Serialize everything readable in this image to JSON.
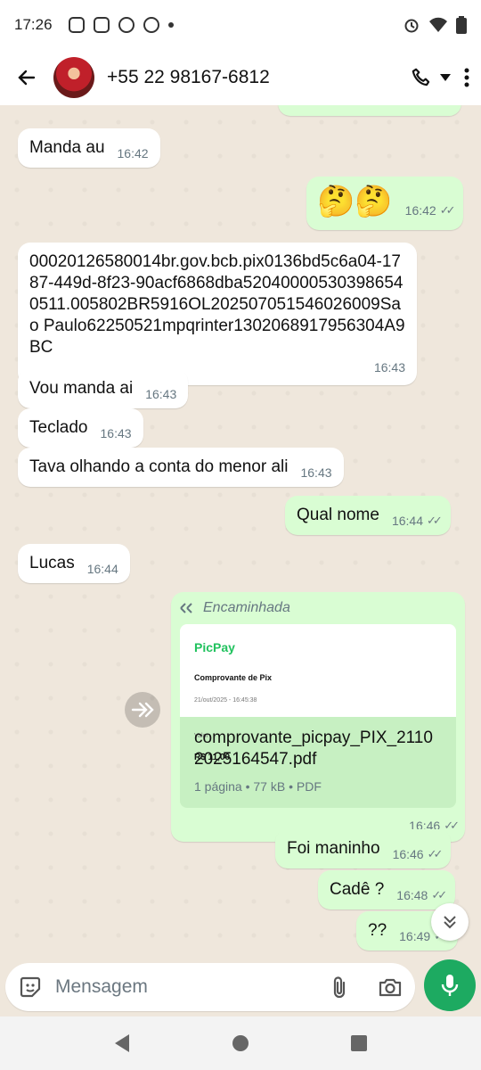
{
  "status_bar": {
    "time": "17:26"
  },
  "header": {
    "contact": "+55 22 98167-6812"
  },
  "messages": [
    {
      "dir": "in",
      "text": "Manda au",
      "time": "16:42"
    },
    {
      "dir": "out",
      "text": "🤔🤔",
      "time": "16:42"
    },
    {
      "dir": "in",
      "text": "00020126580014br.gov.bcb.pix0136bd5c6a04-1787-449d-8f23-90acf6868dba520400005303986540511.005802BR5916OL202507051546026009Sao Paulo62250521mpqrinter1302068917956304A9BC",
      "time": "16:43"
    },
    {
      "dir": "in",
      "text": "Vou manda ai",
      "time": "16:43"
    },
    {
      "dir": "in",
      "text": "Teclado",
      "time": "16:43"
    },
    {
      "dir": "in",
      "text": "Tava olhando a conta do menor ali",
      "time": "16:43"
    },
    {
      "dir": "out",
      "text": "Qual nome",
      "time": "16:44"
    },
    {
      "dir": "in",
      "text": "Lucas",
      "time": "16:44"
    },
    {
      "dir": "out",
      "forwarded_label": "Encaminhada",
      "time": "16:46",
      "document": {
        "preview_brand": "PicPay",
        "preview_title": "Comprovante de Pix",
        "preview_date": "21/out/2025 - 16:45:38",
        "preview_value_label": "Valor",
        "preview_amount": "R$ 11,00",
        "filename": "comprovante_picpay_PIX_21102025164547.pdf",
        "meta": "1 página • 77 kB • PDF"
      }
    },
    {
      "dir": "out",
      "text": "Foi maninho",
      "time": "16:46"
    },
    {
      "dir": "out",
      "text": "Cadê ?",
      "time": "16:48"
    },
    {
      "dir": "out",
      "text": "??",
      "time": "16:49"
    }
  ],
  "composer": {
    "placeholder": "Mensagem"
  },
  "colors": {
    "accent": "#1daa61",
    "outgoing": "#d9fdd3",
    "incoming": "#ffffff"
  }
}
